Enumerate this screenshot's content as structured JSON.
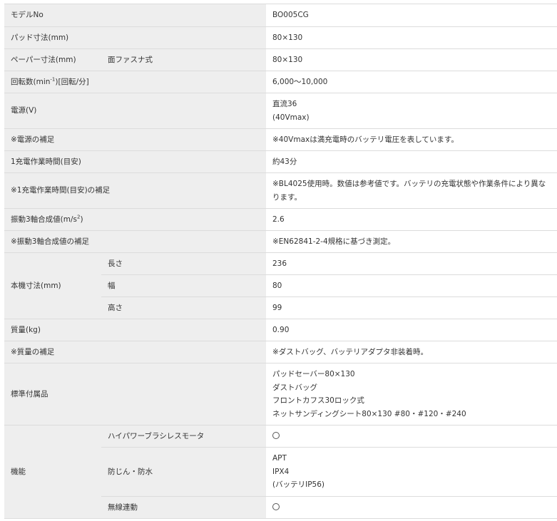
{
  "rows": {
    "model": {
      "label": "モデルNo",
      "value": "BO005CG"
    },
    "pad": {
      "label": "パッド寸法(mm)",
      "value": "80×130"
    },
    "paper": {
      "label": "ペーパー寸法(mm)",
      "sub": "面ファスナ式",
      "value": "80×130"
    },
    "rpm": {
      "label_pre": "回転数(min",
      "label_sup": "-1",
      "label_post": ")[回転/分]",
      "value": "6,000～10,000"
    },
    "power": {
      "label": "電源(V)",
      "lines": [
        "直流36",
        "(40Vmax)"
      ]
    },
    "power_note": {
      "label": "※電源の補足",
      "value": "※40Vmaxは満充電時のバッテリ電圧を表しています。"
    },
    "runtime": {
      "label": "1充電作業時間(目安)",
      "value": "約43分"
    },
    "runtime_note": {
      "label": "※1充電作業時間(目安)の補足",
      "lines": [
        "※BL4025使用時。数値は参考値です。バッテリの充電状態や作業条件により異な",
        "ります。"
      ]
    },
    "vibration": {
      "label_pre": "振動3軸合成値(m/s",
      "label_sup": "2",
      "label_post": ")",
      "value": "2.6"
    },
    "vibration_note": {
      "label": "※振動3軸合成値の補足",
      "value": "※EN62841-2-4規格に基づき測定。"
    },
    "dimensions": {
      "label": "本機寸法(mm)",
      "length": {
        "label": "長さ",
        "value": "236"
      },
      "width": {
        "label": "幅",
        "value": "80"
      },
      "height": {
        "label": "高さ",
        "value": "99"
      }
    },
    "mass": {
      "label": "質量(kg)",
      "value": "0.90"
    },
    "mass_note": {
      "label": "※質量の補足",
      "value": "※ダストバッグ、バッテリアダプタ非装着時。"
    },
    "accessories": {
      "label": "標準付属品",
      "lines": [
        "パッドセーバー80×130",
        "ダストバッグ",
        "フロントカフス30ロック式",
        "ネットサンディングシート80×130 #80・#120・#240"
      ]
    },
    "features": {
      "label": "機能",
      "motor": {
        "label": "ハイパワーブラシレスモータ",
        "value_icon": "circle-mark"
      },
      "dustproof": {
        "label": "防じん・防水",
        "lines": [
          "APT",
          "IPX4",
          "(バッテリIP56)"
        ]
      },
      "wireless": {
        "label": "無線連動",
        "value_icon": "circle-mark"
      }
    }
  }
}
